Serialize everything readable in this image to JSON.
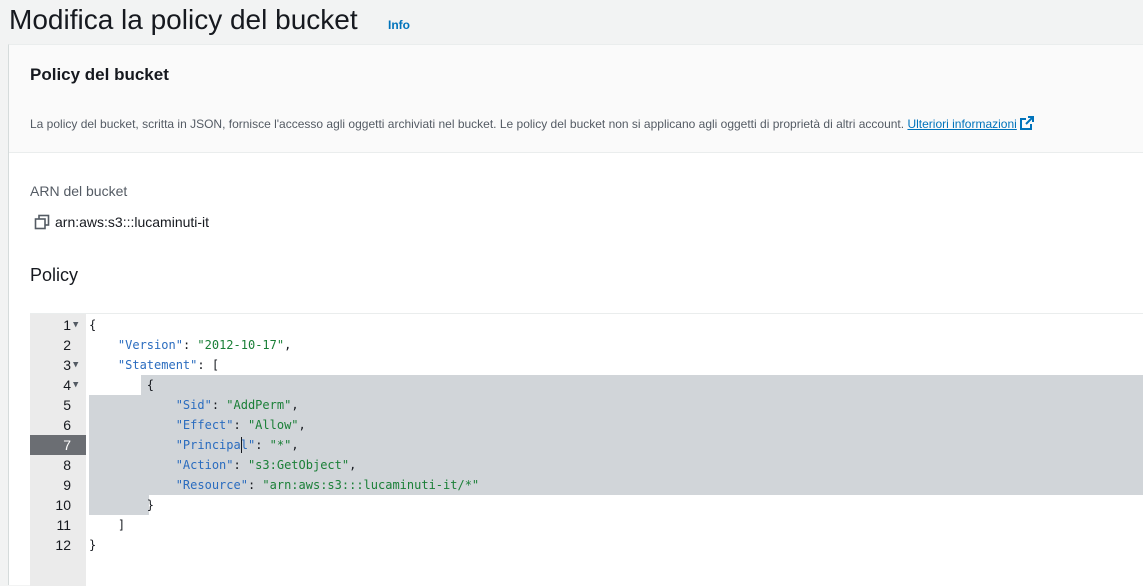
{
  "page": {
    "title": "Modifica la policy del bucket",
    "info_link": "Info"
  },
  "section": {
    "title": "Policy del bucket",
    "description": "La policy del bucket, scritta in JSON, fornisce l'accesso agli oggetti archiviati nel bucket. Le policy del bucket non si applicano agli oggetti di proprietà di altri account.",
    "learn_more": "Ulteriori informazioni"
  },
  "arn": {
    "label": "ARN del bucket",
    "value": "arn:aws:s3:::lucaminuti-it"
  },
  "policy": {
    "label": "Policy",
    "active_line": 7,
    "lines": [
      {
        "n": "1",
        "fold": true,
        "parts": [
          [
            "p",
            "{"
          ]
        ]
      },
      {
        "n": "2",
        "fold": false,
        "parts": [
          [
            "p",
            "    "
          ],
          [
            "k",
            "\"Version\""
          ],
          [
            "p",
            ": "
          ],
          [
            "s",
            "\"2012-10-17\""
          ],
          [
            "p",
            ","
          ]
        ]
      },
      {
        "n": "3",
        "fold": true,
        "parts": [
          [
            "p",
            "    "
          ],
          [
            "k",
            "\"Statement\""
          ],
          [
            "p",
            ": ["
          ]
        ]
      },
      {
        "n": "4",
        "fold": true,
        "parts": [
          [
            "p",
            "        {"
          ]
        ]
      },
      {
        "n": "5",
        "fold": false,
        "parts": [
          [
            "p",
            "            "
          ],
          [
            "k",
            "\"Sid\""
          ],
          [
            "p",
            ": "
          ],
          [
            "s",
            "\"AddPerm\""
          ],
          [
            "p",
            ","
          ]
        ]
      },
      {
        "n": "6",
        "fold": false,
        "parts": [
          [
            "p",
            "            "
          ],
          [
            "k",
            "\"Effect\""
          ],
          [
            "p",
            ": "
          ],
          [
            "s",
            "\"Allow\""
          ],
          [
            "p",
            ","
          ]
        ]
      },
      {
        "n": "7",
        "fold": false,
        "parts": [
          [
            "p",
            "            "
          ],
          [
            "k",
            "\"Principal\""
          ],
          [
            "p",
            ": "
          ],
          [
            "s",
            "\"*\""
          ],
          [
            "p",
            ","
          ]
        ]
      },
      {
        "n": "8",
        "fold": false,
        "parts": [
          [
            "p",
            "            "
          ],
          [
            "k",
            "\"Action\""
          ],
          [
            "p",
            ": "
          ],
          [
            "s",
            "\"s3:GetObject\""
          ],
          [
            "p",
            ","
          ]
        ]
      },
      {
        "n": "9",
        "fold": false,
        "parts": [
          [
            "p",
            "            "
          ],
          [
            "k",
            "\"Resource\""
          ],
          [
            "p",
            ": "
          ],
          [
            "s",
            "\"arn:aws:s3:::lucaminuti-it/*\""
          ]
        ]
      },
      {
        "n": "10",
        "fold": false,
        "parts": [
          [
            "p",
            "        }"
          ]
        ]
      },
      {
        "n": "11",
        "fold": false,
        "parts": [
          [
            "p",
            "    ]"
          ]
        ]
      },
      {
        "n": "12",
        "fold": false,
        "parts": [
          [
            "p",
            "}"
          ]
        ]
      }
    ]
  },
  "icons": {
    "copy": "copy-icon",
    "external": "external-link-icon",
    "fold": "fold-arrow-icon"
  }
}
